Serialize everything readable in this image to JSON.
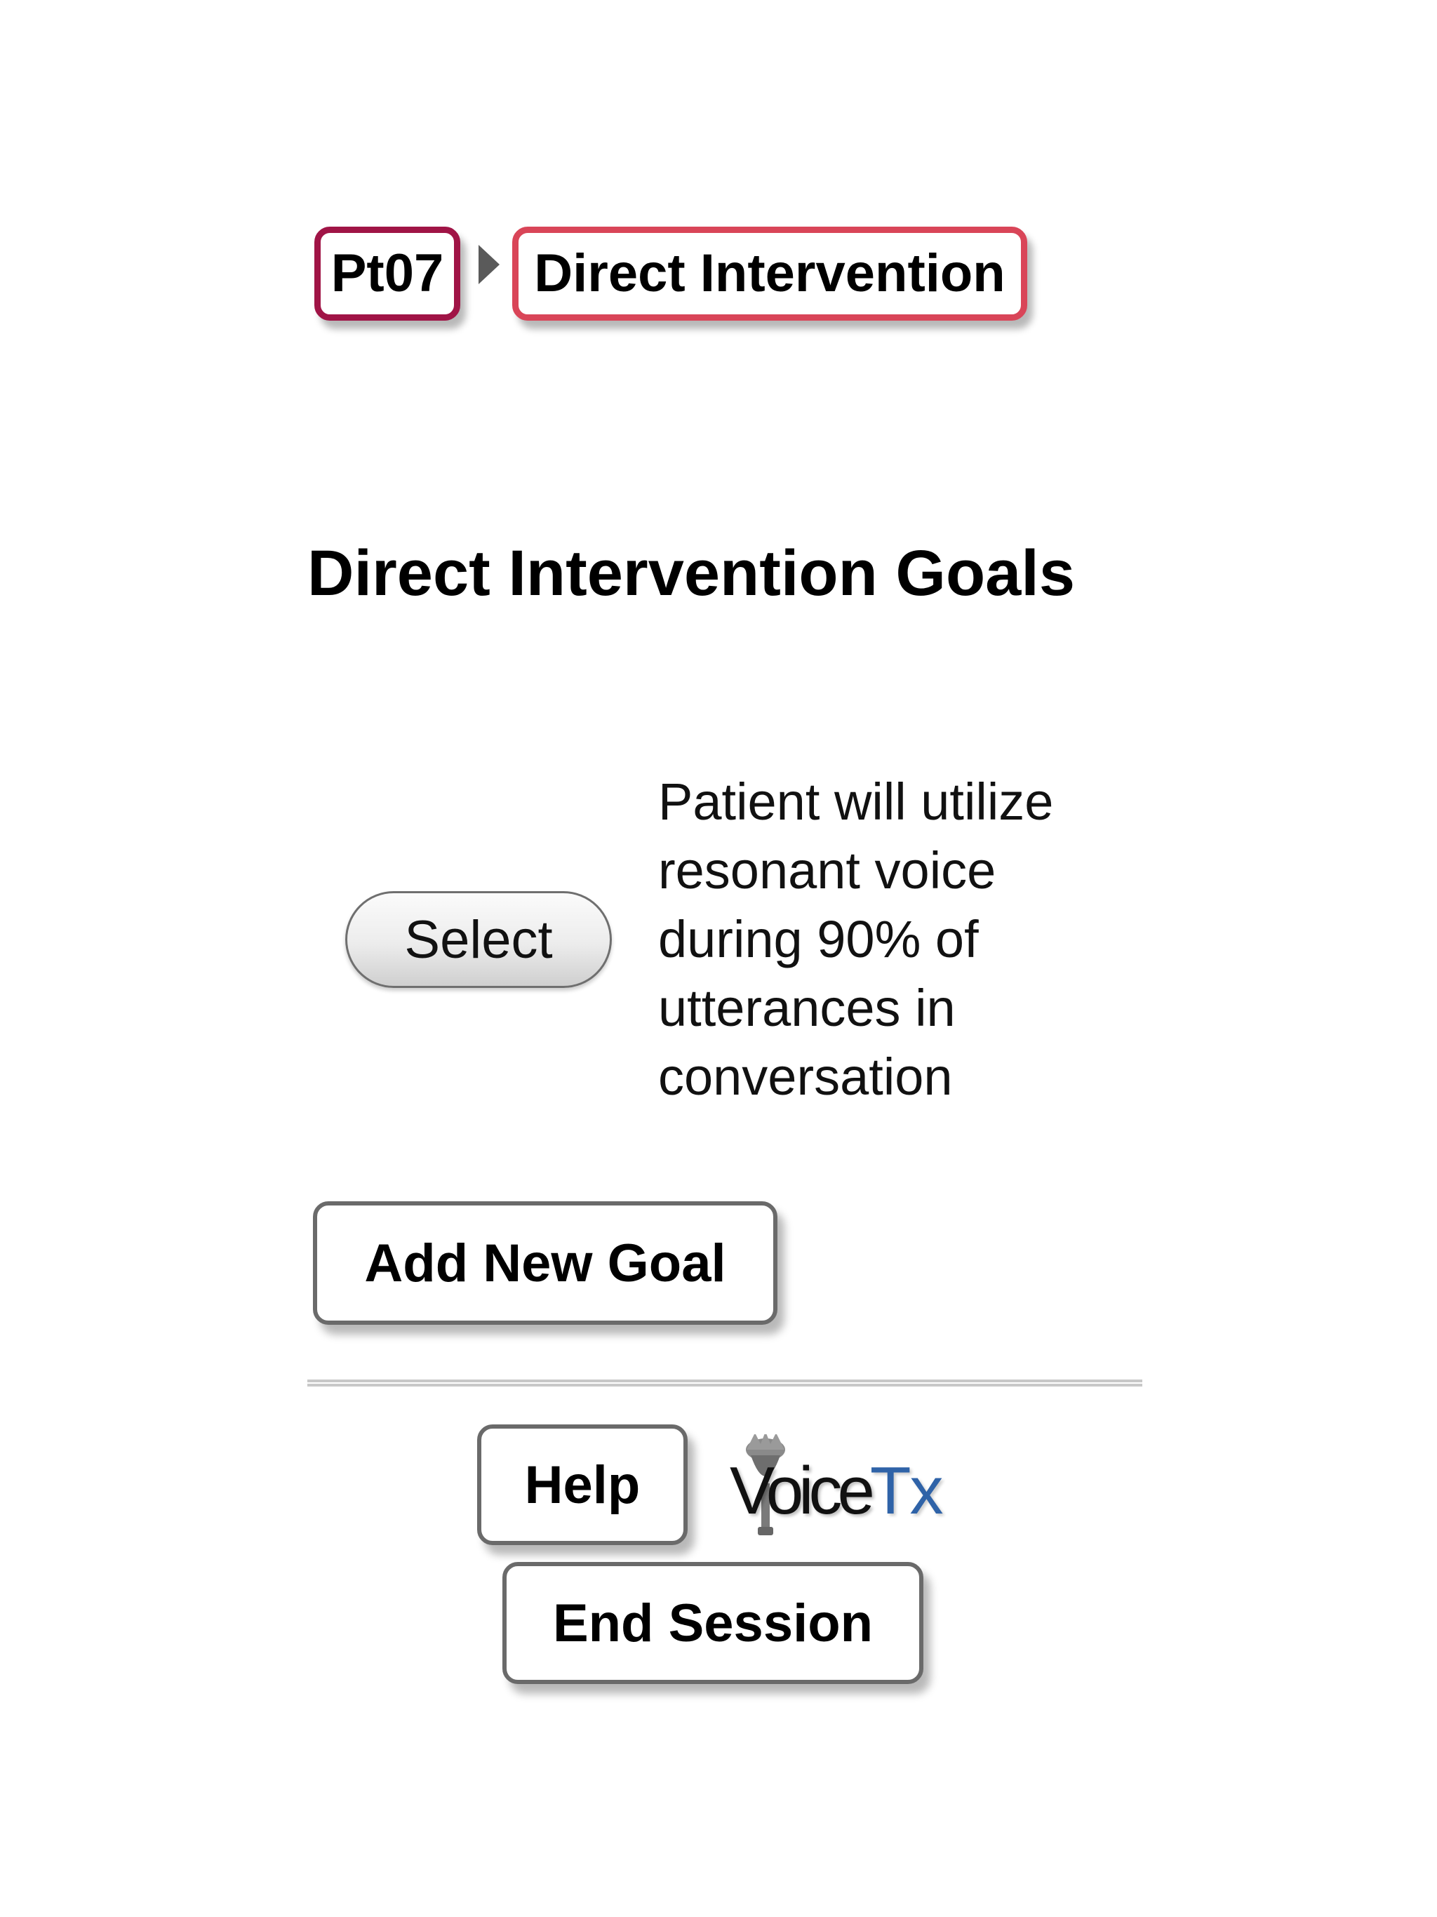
{
  "breadcrumb": {
    "patient_label": "Pt07",
    "current_label": "Direct Intervention"
  },
  "page": {
    "title": "Direct Intervention Goals"
  },
  "goals": [
    {
      "select_label": "Select",
      "description": "Patient will utilize resonant voice during 90% of utterances in conversation"
    }
  ],
  "actions": {
    "add_goal_label": "Add New Goal",
    "help_label": "Help",
    "end_session_label": "End Session"
  },
  "logo": {
    "voice_text": "Voice",
    "tx_text": "Tx",
    "icon": "microphone-icon"
  },
  "colors": {
    "patient_crumb_border": "#a01446",
    "current_crumb_border": "#d94558",
    "logo_accent": "#2f63a8",
    "button_border": "#6a6a6a"
  }
}
